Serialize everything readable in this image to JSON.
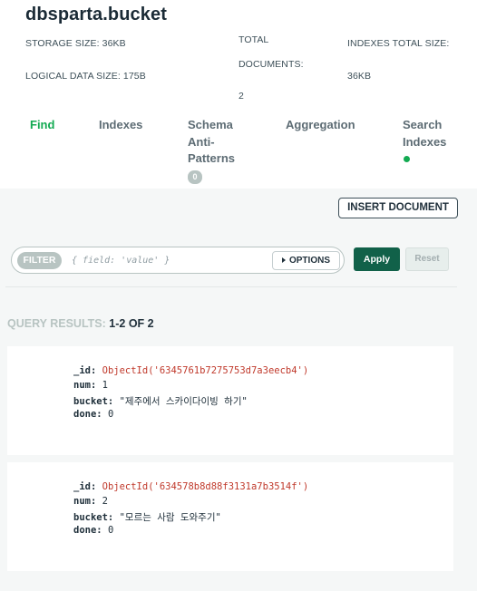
{
  "header": {
    "title": "dbsparta.bucket",
    "stats": {
      "storage_size": "STORAGE SIZE: 36KB",
      "logical_data_size": "LOGICAL DATA SIZE: 175B",
      "total_label_1": "TOTAL",
      "total_label_2": "DOCUMENTS:",
      "total_value": "2",
      "indexes_label": "INDEXES TOTAL SIZE:",
      "indexes_value": "36KB"
    }
  },
  "tabs": {
    "find": "Find",
    "indexes": "Indexes",
    "schema_1": "Schema",
    "schema_2": "Anti-",
    "schema_3": "Patterns",
    "schema_badge": "0",
    "aggregation": "Aggregation",
    "search_1": "Search",
    "search_2": "Indexes"
  },
  "toolbar": {
    "insert_document": "INSERT DOCUMENT",
    "filter_label": "FILTER",
    "filter_placeholder": "{ field: 'value' }",
    "options_label": "OPTIONS",
    "apply_label": "Apply",
    "reset_label": "Reset"
  },
  "results": {
    "label": "QUERY RESULTS: ",
    "count": "1-2 OF 2",
    "documents": [
      {
        "id_key": "_id:",
        "id_value": "ObjectId('6345761b7275753d7a3eecb4')",
        "num_key": "num:",
        "num_value": "1",
        "bucket_key": "bucket:",
        "bucket_value": "\"제주에서 스카이다이빙 하기\"",
        "done_key": "done:",
        "done_value": "0"
      },
      {
        "id_key": "_id:",
        "id_value": "ObjectId('634578b8d88f3131a7b3514f')",
        "num_key": "num:",
        "num_value": "2",
        "bucket_key": "bucket:",
        "bucket_value": "\"모르는 사람 도와주기\"",
        "done_key": "done:",
        "done_value": "0"
      }
    ]
  },
  "colors": {
    "accent_green": "#13aa52",
    "apply_green": "#116149",
    "object_id_red": "#c0392b"
  }
}
